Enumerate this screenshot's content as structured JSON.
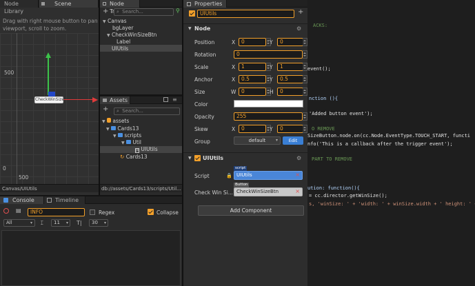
{
  "scene_panel": {
    "tabs": [
      "Node Library",
      "Scene"
    ],
    "hint": "Drag with right mouse button to pan viewport, scroll to zoom.",
    "y_label_500": "500",
    "y_label_0": "0",
    "x_label_500": "500",
    "node_label": "CheckWinSize",
    "footer": "Canvas/UIUtils"
  },
  "node_tree": {
    "tab": "Node Tree",
    "search_placeholder": "Search...",
    "items": [
      "Canvas",
      "bgLayer",
      "CheckWinSizeBtn",
      "Label",
      "UIUtils"
    ]
  },
  "assets": {
    "tab": "Assets",
    "search_placeholder": "Search...",
    "items": [
      "assets",
      "Cards13",
      "scripts",
      "Util",
      "UIUtils",
      "Cards13"
    ],
    "footer": "db://assets/Cards13/scripts/Util..."
  },
  "console": {
    "tabs": [
      "Console",
      "Timeline"
    ],
    "filter_value": "INFO",
    "regex_label": "Regex",
    "collapse_label": "Collapse",
    "level_value": "All",
    "font_size": "11",
    "line_count": "30"
  },
  "properties": {
    "tab": "Properties",
    "node_name": "UIUtils",
    "node_section": "Node",
    "rows": {
      "position": {
        "label": "Position",
        "x": "0",
        "y": "0"
      },
      "rotation": {
        "label": "Rotation",
        "value": "0"
      },
      "scale": {
        "label": "Scale",
        "x": "1",
        "y": "1"
      },
      "anchor": {
        "label": "Anchor",
        "x": "0.5",
        "y": "0.5"
      },
      "size": {
        "label": "Size",
        "w": "0",
        "h": "0"
      },
      "color": {
        "label": "Color"
      },
      "opacity": {
        "label": "Opacity",
        "value": "255"
      },
      "skew": {
        "label": "Skew",
        "x": "0",
        "y": "0"
      },
      "group": {
        "label": "Group",
        "value": "default",
        "edit": "Edit"
      }
    },
    "axis": {
      "x": "X",
      "y": "Y",
      "w": "W",
      "h": "H"
    },
    "component_section": "UIUtils",
    "script_label": "Script",
    "script_badge": "script",
    "script_value": "UIUtils",
    "check_label": "Check Win Si...",
    "check_badge": "Button",
    "check_value": "CheckWinSizeBtn",
    "add_component": "Add Component"
  },
  "code_lines": [
    "ACKS:",
    "event();",
    "nction (){",
    "'Added button event');",
    "O REMOVE",
    "SizeButton.node.on(cc.Node.EventType.TOUCH_START, functi",
    "nfo('This is a callback after the trigger event');",
    "PART TO REMOVE",
    "ution: function(){",
    "= cc.director.getWinSize();",
    "s, 'winSize: ' + 'width: ' + winSize.width + ' height: ' +"
  ]
}
